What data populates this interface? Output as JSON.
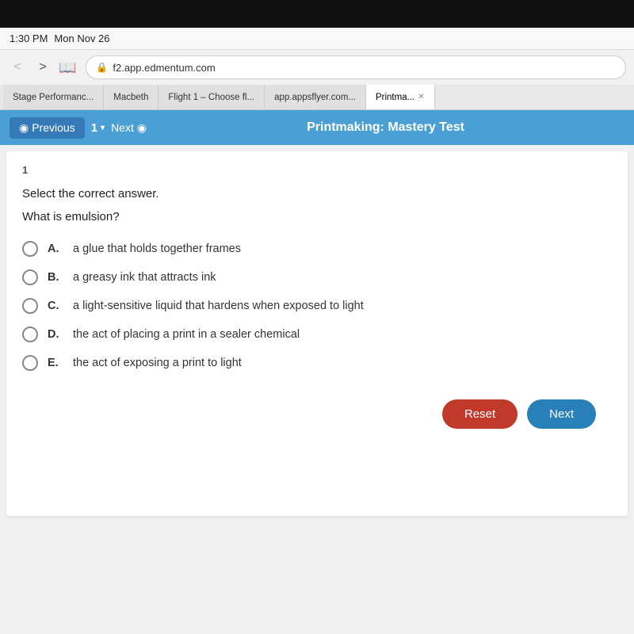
{
  "device": {
    "top_bar_color": "#111"
  },
  "status_bar": {
    "time": "1:30 PM",
    "date": "Mon Nov 26"
  },
  "browser": {
    "back_btn": "<",
    "forward_btn": ">",
    "book_icon": "📖",
    "url": "f2.app.edmentum.com",
    "lock_icon": "🔒"
  },
  "tabs": [
    {
      "label": "Stage Performanc...",
      "active": false
    },
    {
      "label": "Macbeth",
      "active": false
    },
    {
      "label": "Flight 1 – Choose fl...",
      "active": false
    },
    {
      "label": "app.appsflyer.com...",
      "active": false
    },
    {
      "label": "Printma...",
      "active": true
    }
  ],
  "quiz_nav": {
    "previous_label": "Previous",
    "question_number": "1",
    "dropdown_arrow": "▾",
    "next_label": "Next",
    "title": "Printmaking: Mastery Test"
  },
  "question": {
    "number": "1",
    "instruction": "Select the correct answer.",
    "text": "What is emulsion?",
    "choices": [
      {
        "id": "A",
        "text": "a glue that holds together frames"
      },
      {
        "id": "B",
        "text": "a greasy ink that attracts ink"
      },
      {
        "id": "C",
        "text": "a light-sensitive liquid that hardens when exposed to light"
      },
      {
        "id": "D",
        "text": "the act of placing a print in a sealer chemical"
      },
      {
        "id": "E",
        "text": "the act of exposing a print to light"
      }
    ]
  },
  "actions": {
    "reset_label": "Reset",
    "next_label": "Next"
  }
}
